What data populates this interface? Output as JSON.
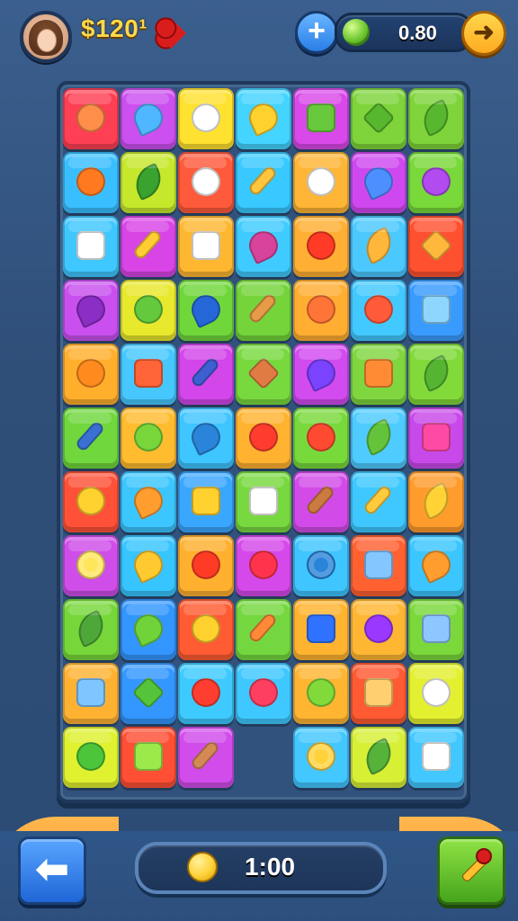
{
  "header": {
    "coin_amount": "$120¹",
    "resource_value": "0.80",
    "plus_icon": "plus-icon",
    "heart_icon": "heart-icon",
    "arrow_icon": "arrow-right-icon",
    "avatar_icon": "avatar-icon"
  },
  "board": {
    "columns": 7,
    "rows": 11,
    "tiles": [
      {
        "row": 0,
        "col": 0,
        "color": "#ff3f53",
        "icon": "heart-fruit-icon",
        "shape": "round"
      },
      {
        "row": 0,
        "col": 1,
        "color": "#cc4ff0",
        "icon": "fish-icon",
        "shape": "drop"
      },
      {
        "row": 0,
        "col": 2,
        "color": "#ffe12f",
        "icon": "egg-icon",
        "shape": "round"
      },
      {
        "row": 0,
        "col": 3,
        "color": "#43d4ff",
        "icon": "lemon-icon",
        "shape": "drop"
      },
      {
        "row": 0,
        "col": 4,
        "color": "#d948e8",
        "icon": "lantern-icon",
        "shape": "square"
      },
      {
        "row": 0,
        "col": 5,
        "color": "#7ed43a",
        "icon": "house-icon",
        "shape": "diamond"
      },
      {
        "row": 0,
        "col": 6,
        "color": "#7ed43a",
        "icon": "lime-icon",
        "shape": "leaf"
      },
      {
        "row": 1,
        "col": 0,
        "color": "#39bfff",
        "icon": "orange-icon",
        "shape": "round"
      },
      {
        "row": 1,
        "col": 1,
        "color": "#c6e82c",
        "icon": "leaf-icon",
        "shape": "leaf"
      },
      {
        "row": 1,
        "col": 2,
        "color": "#ff5a3b",
        "icon": "star-face-icon",
        "shape": "star"
      },
      {
        "row": 1,
        "col": 3,
        "color": "#37c9ff",
        "icon": "branch-icon",
        "shape": "stick"
      },
      {
        "row": 1,
        "col": 4,
        "color": "#ffb535",
        "icon": "atom-icon",
        "shape": "round"
      },
      {
        "row": 1,
        "col": 5,
        "color": "#cf48ef",
        "icon": "guitar-icon",
        "shape": "drop"
      },
      {
        "row": 1,
        "col": 6,
        "color": "#79d83a",
        "icon": "cloud-icon",
        "shape": "round"
      },
      {
        "row": 2,
        "col": 0,
        "color": "#3fc7ff",
        "icon": "basket-icon",
        "shape": "square"
      },
      {
        "row": 2,
        "col": 1,
        "color": "#d844e6",
        "icon": "feather-icon",
        "shape": "stick"
      },
      {
        "row": 2,
        "col": 2,
        "color": "#ffb732",
        "icon": "cow-icon",
        "shape": "square"
      },
      {
        "row": 2,
        "col": 3,
        "color": "#3fcbff",
        "icon": "radish-icon",
        "shape": "drop"
      },
      {
        "row": 2,
        "col": 4,
        "color": "#ffaf33",
        "icon": "apple-icon",
        "shape": "round"
      },
      {
        "row": 2,
        "col": 5,
        "color": "#4bc9ff",
        "icon": "seashell-icon",
        "shape": "leaf"
      },
      {
        "row": 2,
        "col": 6,
        "color": "#ff5130",
        "icon": "triangle-icon",
        "shape": "diamond"
      },
      {
        "row": 3,
        "col": 0,
        "color": "#c950ee",
        "icon": "eggplant-icon",
        "shape": "drop"
      },
      {
        "row": 3,
        "col": 1,
        "color": "#e8e82d",
        "icon": "chat-icon",
        "shape": "round"
      },
      {
        "row": 3,
        "col": 2,
        "color": "#70d73b",
        "icon": "rocket-icon",
        "shape": "drop"
      },
      {
        "row": 3,
        "col": 3,
        "color": "#74d43a",
        "icon": "marker-icon",
        "shape": "stick"
      },
      {
        "row": 3,
        "col": 4,
        "color": "#ffae31",
        "icon": "sun-face-icon",
        "shape": "round"
      },
      {
        "row": 3,
        "col": 5,
        "color": "#42c9ff",
        "icon": "donut-icon",
        "shape": "round"
      },
      {
        "row": 3,
        "col": 6,
        "color": "#3a9bff",
        "icon": "puzzle-icon",
        "shape": "square"
      },
      {
        "row": 4,
        "col": 0,
        "color": "#ffaf2c",
        "icon": "bird-icon",
        "shape": "round"
      },
      {
        "row": 4,
        "col": 1,
        "color": "#46c8ff",
        "icon": "hand-icon",
        "shape": "square"
      },
      {
        "row": 4,
        "col": 2,
        "color": "#d246ea",
        "icon": "knife-icon",
        "shape": "stick"
      },
      {
        "row": 4,
        "col": 3,
        "color": "#78d93f",
        "icon": "cookie-icon",
        "shape": "diamond"
      },
      {
        "row": 4,
        "col": 4,
        "color": "#d24bef",
        "icon": "pill-icon",
        "shape": "drop"
      },
      {
        "row": 4,
        "col": 5,
        "color": "#7fd63f",
        "icon": "pot-icon",
        "shape": "square"
      },
      {
        "row": 4,
        "col": 6,
        "color": "#81d93a",
        "icon": "grape-icon",
        "shape": "leaf"
      },
      {
        "row": 5,
        "col": 0,
        "color": "#70d73c",
        "icon": "pencil-icon",
        "shape": "stick"
      },
      {
        "row": 5,
        "col": 1,
        "color": "#ffbc2f",
        "icon": "pepper-icon",
        "shape": "round"
      },
      {
        "row": 5,
        "col": 2,
        "color": "#3fc5ff",
        "icon": "bottle-icon",
        "shape": "drop"
      },
      {
        "row": 5,
        "col": 3,
        "color": "#ffb22f",
        "icon": "target-icon",
        "shape": "round"
      },
      {
        "row": 5,
        "col": 4,
        "color": "#78d93b",
        "icon": "berry-icon",
        "shape": "round"
      },
      {
        "row": 5,
        "col": 5,
        "color": "#4ecbff",
        "icon": "leafy-icon",
        "shape": "leaf"
      },
      {
        "row": 5,
        "col": 6,
        "color": "#c849ea",
        "icon": "box-icon",
        "shape": "square"
      },
      {
        "row": 6,
        "col": 0,
        "color": "#ff5137",
        "icon": "smile-icon",
        "shape": "round"
      },
      {
        "row": 6,
        "col": 1,
        "color": "#3bc6ff",
        "icon": "mango-icon",
        "shape": "drop"
      },
      {
        "row": 6,
        "col": 2,
        "color": "#3aa7ff",
        "icon": "cheese-icon",
        "shape": "square"
      },
      {
        "row": 6,
        "col": 3,
        "color": "#78d83f",
        "icon": "tray-icon",
        "shape": "square"
      },
      {
        "row": 6,
        "col": 4,
        "color": "#d24be8",
        "icon": "baguette-icon",
        "shape": "stick"
      },
      {
        "row": 6,
        "col": 5,
        "color": "#3ec8ff",
        "icon": "arrow-branch-icon",
        "shape": "stick"
      },
      {
        "row": 6,
        "col": 6,
        "color": "#ff9c2c",
        "icon": "bananas-icon",
        "shape": "leaf"
      },
      {
        "row": 7,
        "col": 0,
        "color": "#cf4de8",
        "icon": "flower-icon",
        "shape": "star"
      },
      {
        "row": 7,
        "col": 1,
        "color": "#37c5ff",
        "icon": "pear-icon",
        "shape": "drop"
      },
      {
        "row": 7,
        "col": 2,
        "color": "#ffb02f",
        "icon": "tomato-icon",
        "shape": "round"
      },
      {
        "row": 7,
        "col": 3,
        "color": "#d549ea",
        "icon": "cherry-icon",
        "shape": "round"
      },
      {
        "row": 7,
        "col": 4,
        "color": "#3fc5ff",
        "icon": "duck-icon",
        "shape": "star"
      },
      {
        "row": 7,
        "col": 5,
        "color": "#ff6131",
        "icon": "cat-icon",
        "shape": "square"
      },
      {
        "row": 7,
        "col": 6,
        "color": "#3bc6ff",
        "icon": "olive-icon",
        "shape": "drop"
      },
      {
        "row": 8,
        "col": 0,
        "color": "#77d73a",
        "icon": "lettuce-icon",
        "shape": "leaf"
      },
      {
        "row": 8,
        "col": 1,
        "color": "#3396ff",
        "icon": "avocado-icon",
        "shape": "drop"
      },
      {
        "row": 8,
        "col": 2,
        "color": "#ff5c33",
        "icon": "orange-ball-icon",
        "shape": "round"
      },
      {
        "row": 8,
        "col": 3,
        "color": "#75d73f",
        "icon": "crayon-icon",
        "shape": "stick"
      },
      {
        "row": 8,
        "col": 4,
        "color": "#ffb32f",
        "icon": "monster-icon",
        "shape": "square"
      },
      {
        "row": 8,
        "col": 5,
        "color": "#ffb633",
        "icon": "plum-icon",
        "shape": "round"
      },
      {
        "row": 8,
        "col": 6,
        "color": "#7bd83b",
        "icon": "puzzle-piece-icon",
        "shape": "square"
      },
      {
        "row": 9,
        "col": 0,
        "color": "#ffb232",
        "icon": "bag-icon",
        "shape": "square"
      },
      {
        "row": 9,
        "col": 1,
        "color": "#3397ff",
        "icon": "triangle-leaf-icon",
        "shape": "diamond"
      },
      {
        "row": 9,
        "col": 2,
        "color": "#3ecaff",
        "icon": "strawberry-icon",
        "shape": "round"
      },
      {
        "row": 9,
        "col": 3,
        "color": "#3fc8ff",
        "icon": "donut-purple-icon",
        "shape": "round"
      },
      {
        "row": 9,
        "col": 4,
        "color": "#ffb532",
        "icon": "happy-face-icon",
        "shape": "round"
      },
      {
        "row": 9,
        "col": 5,
        "color": "#ff5a31",
        "icon": "glove-icon",
        "shape": "square"
      },
      {
        "row": 9,
        "col": 6,
        "color": "#e3f02f",
        "icon": "ghost-icon",
        "shape": "star"
      },
      {
        "row": 10,
        "col": 0,
        "color": "#dff12f",
        "icon": "green-ball-icon",
        "shape": "round"
      },
      {
        "row": 10,
        "col": 1,
        "color": "#ff4f35",
        "icon": "block-face-icon",
        "shape": "square"
      },
      {
        "row": 10,
        "col": 2,
        "color": "#d14ceb",
        "icon": "bread-icon",
        "shape": "stick"
      },
      {
        "row": 10,
        "col": 4,
        "color": "#42c7ff",
        "icon": "flower-yellow-icon",
        "shape": "star"
      },
      {
        "row": 10,
        "col": 5,
        "color": "#d7ef35",
        "icon": "watermelon-icon",
        "shape": "leaf"
      },
      {
        "row": 10,
        "col": 6,
        "color": "#42c8ff",
        "icon": "crate-icon",
        "shape": "square"
      }
    ]
  },
  "footer": {
    "timer": "1:00",
    "back_icon": "back-arrow-icon",
    "coin_icon": "coin-icon",
    "hint_icon": "magic-wand-icon"
  }
}
